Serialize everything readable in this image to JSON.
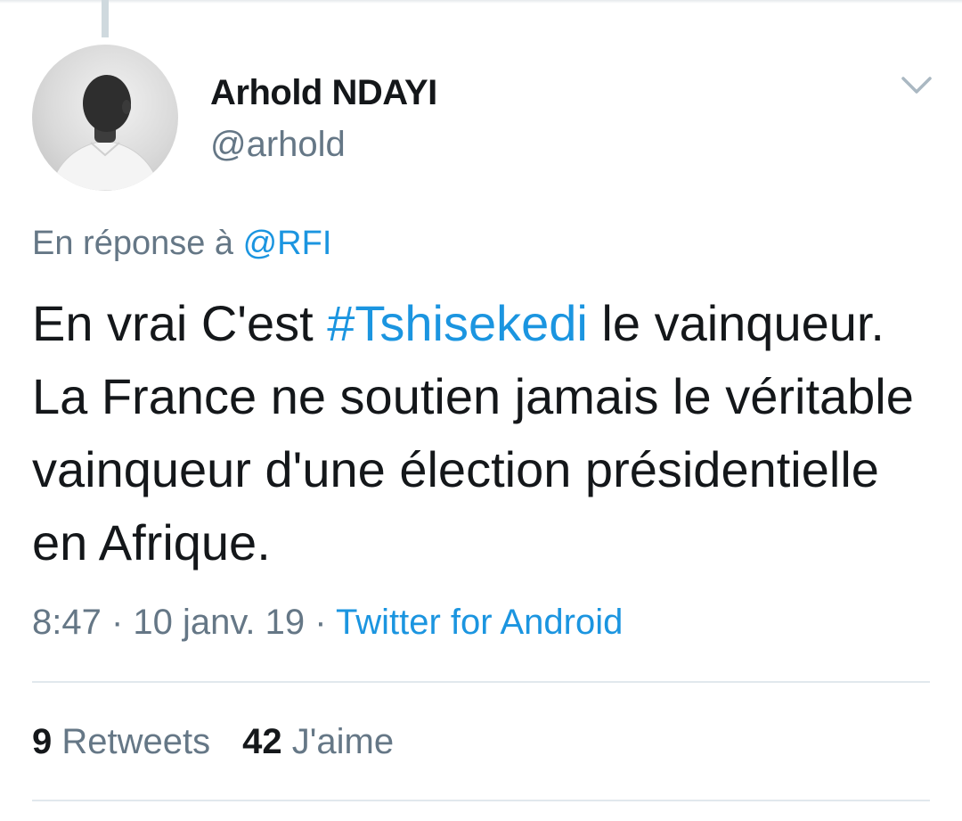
{
  "tweet": {
    "author": {
      "display_name": "Arhold NDAYI",
      "handle": "@arhold",
      "avatar": "profile-photo"
    },
    "menu_icon": "chevron-down-icon",
    "reply_context": {
      "prefix": "En réponse à ",
      "mention": "@RFI"
    },
    "text": {
      "part1": "En vrai C'est ",
      "hashtag": "#Tshisekedi",
      "part2": " le vainqueur. La France ne soutien jamais le véritable vainqueur d'une élection présidentielle en Afrique."
    },
    "meta": {
      "time": "8:47",
      "separator1": " · ",
      "date": "10 janv. 19",
      "separator2": " · ",
      "source": "Twitter for Android"
    },
    "stats": {
      "retweets_count": "9",
      "retweets_label": " Retweets",
      "likes_count": "42",
      "likes_label": " J'aime"
    }
  },
  "colors": {
    "link_blue": "#1b95e0",
    "secondary_gray": "#657786",
    "text_dark": "#14171a",
    "divider": "#e1e8ed"
  }
}
